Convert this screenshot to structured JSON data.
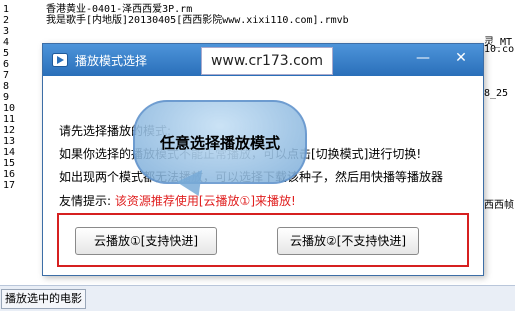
{
  "playlist": {
    "rows": [
      {
        "num": "1",
        "name": "香港黄业-0401-泽西西爱3P.rm"
      },
      {
        "num": "2",
        "name": "我是歌手[内地版]20130405[西西影院www.xixi110.com].rmvb"
      },
      {
        "num": "3",
        "name": ""
      },
      {
        "num": "4",
        "name": ""
      },
      {
        "num": "5",
        "name": ""
      },
      {
        "num": "6",
        "name": ""
      },
      {
        "num": "7",
        "name": ""
      },
      {
        "num": "8",
        "name": ""
      },
      {
        "num": "9",
        "name": ""
      },
      {
        "num": "10",
        "name": ""
      },
      {
        "num": "11",
        "name": ""
      },
      {
        "num": "12",
        "name": ""
      },
      {
        "num": "13",
        "name": ""
      },
      {
        "num": "14",
        "name": ""
      },
      {
        "num": "15",
        "name": ""
      },
      {
        "num": "16",
        "name": ""
      },
      {
        "num": "17",
        "name": ""
      }
    ],
    "right_texts": [
      "灵_MT",
      "10.co",
      "8_25",
      "西西帧"
    ]
  },
  "statusbar": {
    "play_selected": "播放选中的电影"
  },
  "dialog": {
    "title": "播放模式选择",
    "url": "www.cr173.com",
    "minimize": "—",
    "close": "✕",
    "line1": "请先选择播放的模式:",
    "line2": "如果你选择的播放模式不能正常播放，可以点击[切换模式]进行切换!",
    "line3": "如出现两个模式都无法播放，可以选择下载该种子，然后用快播等播放器",
    "tip_label": "友情提示:",
    "tip_text": "该资源推荐使用[云播放①]来播放!",
    "btn_cloud1": "云播放①[支持快进]",
    "btn_cloud2": "云播放②[不支持快进]"
  },
  "tooltip": {
    "text": "任意选择播放模式"
  },
  "colors": {
    "titlebar": "#2a6fb9",
    "tip": "#e02020",
    "frame": "#d62020"
  }
}
